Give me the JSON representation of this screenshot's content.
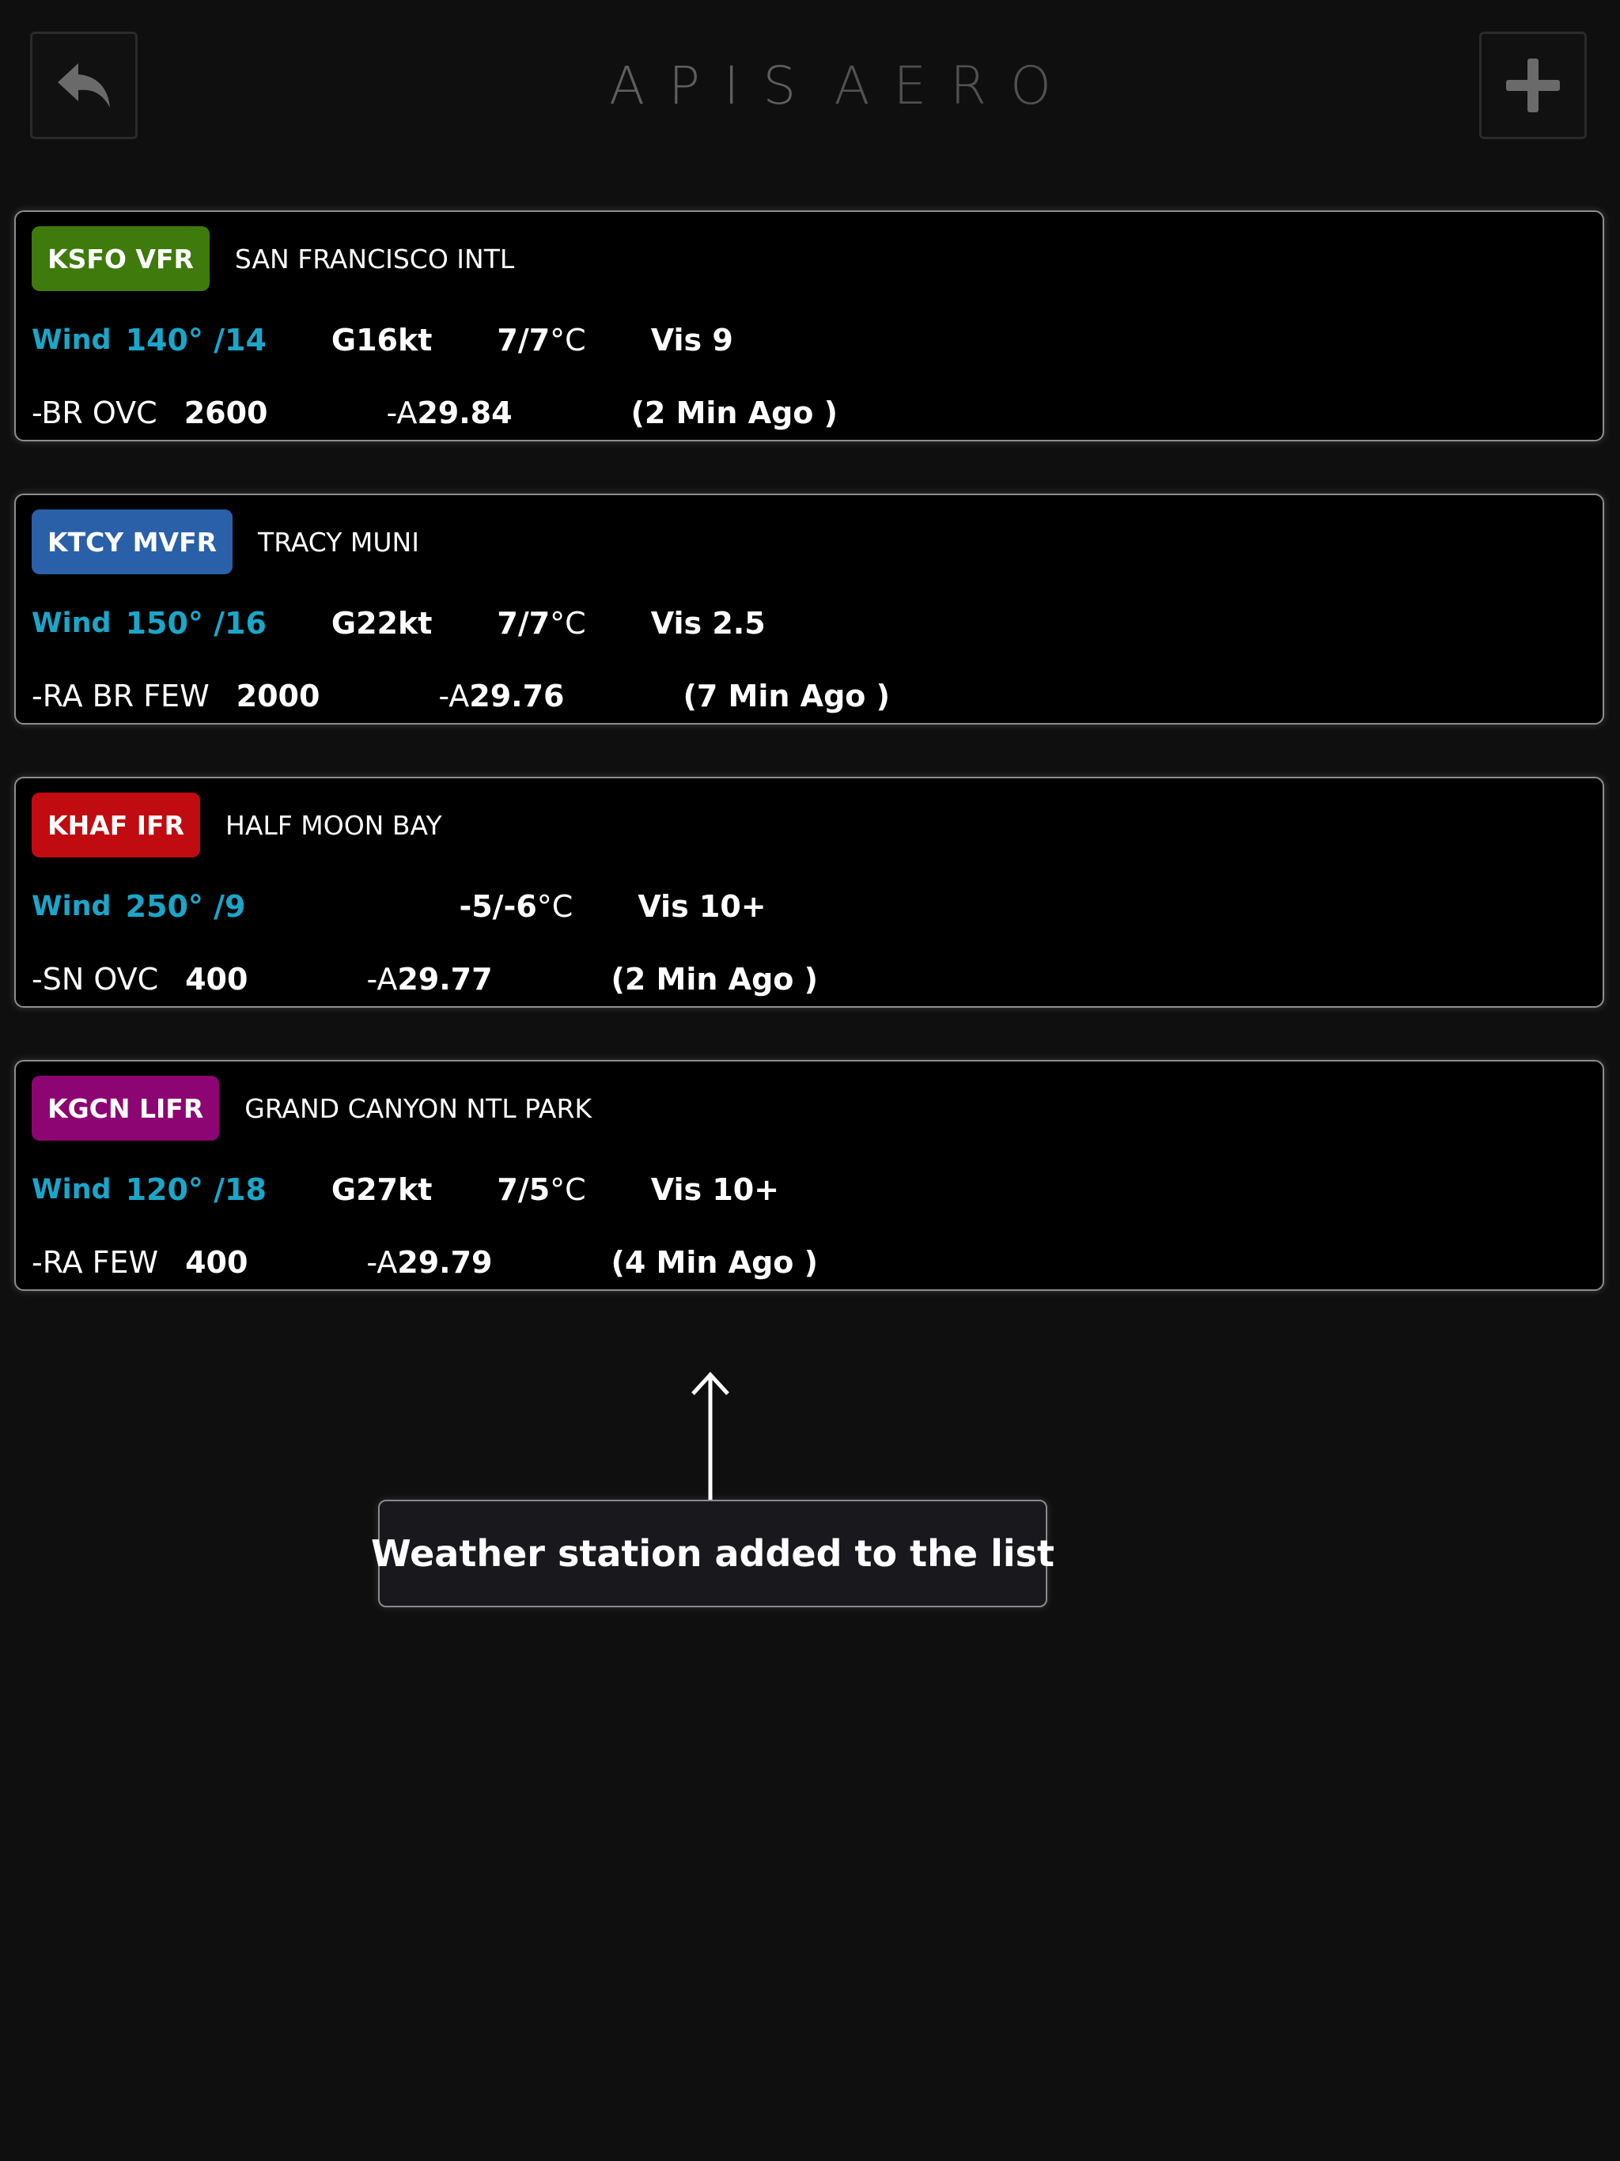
{
  "header": {
    "logo_left": "APIS",
    "logo_right": "AERO",
    "back_icon": "back-arrow-icon",
    "add_icon": "plus-icon"
  },
  "stations": [
    {
      "badge": "KSFO VFR",
      "badge_color": "#3f7a0c",
      "name": "SAN FRANCISCO INTL",
      "wind_label": "Wind",
      "wind": "140° /14",
      "gust": "G16kt",
      "temp": "7/7",
      "temp_unit": "°C",
      "vis": "Vis 9",
      "cond": "-BR OVC",
      "ceiling": "2600",
      "alt_prefix": "-A",
      "alt": "29.84",
      "age": "(2 Min Ago )"
    },
    {
      "badge": "KTCY MVFR",
      "badge_color": "#2a60a8",
      "name": "TRACY MUNI",
      "wind_label": "Wind",
      "wind": "150° /16",
      "gust": "G22kt",
      "temp": "7/7",
      "temp_unit": "°C",
      "vis": "Vis 2.5",
      "cond": "-RA BR FEW",
      "ceiling": "2000",
      "alt_prefix": "-A",
      "alt": "29.76",
      "age": "(7 Min Ago )"
    },
    {
      "badge": "KHAF IFR",
      "badge_color": "#c00b10",
      "name": "HALF MOON BAY",
      "wind_label": "Wind",
      "wind": "250° /9",
      "gust": "",
      "temp": "-5/-6",
      "temp_unit": "°C",
      "vis": "Vis 10+",
      "cond": "-SN OVC",
      "ceiling": "400",
      "alt_prefix": "-A",
      "alt": "29.77",
      "age": "(2 Min Ago )"
    },
    {
      "badge": "KGCN LIFR",
      "badge_color": "#8c0572",
      "name": "GRAND CANYON NTL PARK",
      "wind_label": "Wind",
      "wind": "120° /18",
      "gust": "G27kt",
      "temp": "7/5",
      "temp_unit": "°C",
      "vis": "Vis 10+",
      "cond": "-RA FEW",
      "ceiling": "400",
      "alt_prefix": "-A",
      "alt": "29.79",
      "age": "(4 Min Ago )"
    }
  ],
  "toast": {
    "message": "Weather station added to the list",
    "icon": "up-arrow-icon"
  }
}
